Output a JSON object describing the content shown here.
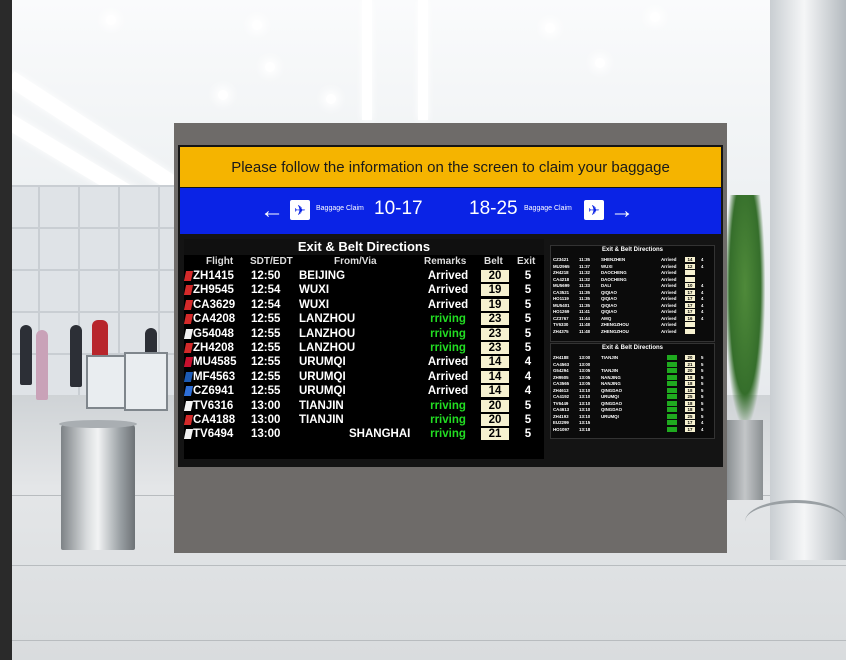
{
  "sign": {
    "banner": "Please follow the information on the screen to claim your baggage",
    "left_claim_label": "Baggage Claim",
    "left_claim_range": "10-17",
    "right_claim_range": "18-25",
    "right_claim_label": "Baggage Claim",
    "colors": {
      "yellow": "#f5b400",
      "blue": "#0a23e6",
      "arrived": "#ffffff",
      "arriving": "#22dd22"
    }
  },
  "main_board": {
    "title": "Exit & Belt Directions",
    "headers": {
      "flight": "Flight",
      "time": "SDT/EDT",
      "city": "From/Via",
      "remarks": "Remarks",
      "belt": "Belt",
      "exit": "Exit"
    },
    "rows": [
      {
        "flight": "ZH1415",
        "time": "12:50",
        "city": "BEIJING",
        "remarks": "Arrived",
        "belt": "20",
        "exit": "5",
        "status": "arrived",
        "logo": "#d42a2a"
      },
      {
        "flight": "ZH9545",
        "time": "12:54",
        "city": "WUXI",
        "remarks": "Arrived",
        "belt": "19",
        "exit": "5",
        "status": "arrived",
        "logo": "#d42a2a"
      },
      {
        "flight": "CA3629",
        "time": "12:54",
        "city": "WUXI",
        "remarks": "Arrived",
        "belt": "19",
        "exit": "5",
        "status": "arrived",
        "logo": "#d42a2a"
      },
      {
        "flight": "CA4208",
        "time": "12:55",
        "city": "LANZHOU",
        "remarks": "rriving",
        "belt": "23",
        "exit": "5",
        "status": "arriving",
        "logo": "#d42a2a"
      },
      {
        "flight": "G54048",
        "time": "12:55",
        "city": "LANZHOU",
        "remarks": "rriving",
        "belt": "23",
        "exit": "5",
        "status": "arriving",
        "logo": "#f2f2f2"
      },
      {
        "flight": "ZH4208",
        "time": "12:55",
        "city": "LANZHOU",
        "remarks": "rriving",
        "belt": "23",
        "exit": "5",
        "status": "arriving",
        "logo": "#d42a2a"
      },
      {
        "flight": "MU4585",
        "time": "12:55",
        "city": "URUMQI",
        "remarks": "Arrived",
        "belt": "14",
        "exit": "4",
        "status": "arrived",
        "logo": "#c8102e"
      },
      {
        "flight": "MF4563",
        "time": "12:55",
        "city": "URUMQI",
        "remarks": "Arrived",
        "belt": "14",
        "exit": "4",
        "status": "arrived",
        "logo": "#1c5bb5"
      },
      {
        "flight": "CZ6941",
        "time": "12:55",
        "city": "URUMQI",
        "remarks": "Arrived",
        "belt": "14",
        "exit": "4",
        "status": "arrived",
        "logo": "#2e6fd8"
      },
      {
        "flight": "TV6316",
        "time": "13:00",
        "city": "TIANJIN",
        "remarks": "rriving",
        "belt": "20",
        "exit": "5",
        "status": "arriving",
        "logo": "#f2f2f2"
      },
      {
        "flight": "CA4188",
        "time": "13:00",
        "city": "TIANJIN",
        "remarks": "rriving",
        "belt": "20",
        "exit": "5",
        "status": "arriving",
        "logo": "#d42a2a"
      },
      {
        "flight": "TV6494",
        "time": "13:00",
        "city": "SHANGHAI",
        "remarks": "rriving",
        "belt": "21",
        "exit": "5",
        "status": "arriving",
        "logo": "#f2f2f2"
      }
    ]
  },
  "mini_board_top": {
    "title": "Exit & Belt Directions",
    "rows": [
      {
        "flight": "CZ3421",
        "time": "11:35",
        "city": "SHENZHEN",
        "remarks": "Arrived",
        "belt": "14",
        "exit": "4"
      },
      {
        "flight": "MU2965",
        "time": "11:37",
        "city": "WUXI",
        "remarks": "Arrived",
        "belt": "12",
        "exit": "4"
      },
      {
        "flight": "ZH4218",
        "time": "11:32",
        "city": "DAOCHENG",
        "remarks": "Arrived",
        "belt": "",
        "exit": ""
      },
      {
        "flight": "CA4218",
        "time": "11:32",
        "city": "DAOCHENG",
        "remarks": "Arrived",
        "belt": "",
        "exit": ""
      },
      {
        "flight": "MU5699",
        "time": "11:33",
        "city": "DALI",
        "remarks": "Arrived",
        "belt": "10",
        "exit": "4"
      },
      {
        "flight": "CA3521",
        "time": "11:35",
        "city": "QIQIAO",
        "remarks": "Arrived",
        "belt": "17",
        "exit": "4"
      },
      {
        "flight": "HO1119",
        "time": "11:35",
        "city": "QIQIAO",
        "remarks": "Arrived",
        "belt": "17",
        "exit": "4"
      },
      {
        "flight": "MU5401",
        "time": "11:35",
        "city": "QIQIAO",
        "remarks": "Arrived",
        "belt": "17",
        "exit": "4"
      },
      {
        "flight": "HO1269",
        "time": "11:41",
        "city": "QIQIAO",
        "remarks": "Arrived",
        "belt": "17",
        "exit": "4"
      },
      {
        "flight": "CZ3767",
        "time": "11:44",
        "city": "AMQ",
        "remarks": "Arrived",
        "belt": "16",
        "exit": "4"
      },
      {
        "flight": "TV6330",
        "time": "11:48",
        "city": "ZHENGZHOU",
        "remarks": "Arrived",
        "belt": "",
        "exit": ""
      },
      {
        "flight": "ZH4375",
        "time": "11:48",
        "city": "ZHENGZHOU",
        "remarks": "Arrived",
        "belt": "",
        "exit": ""
      }
    ]
  },
  "mini_board_bottom": {
    "title": "Exit & Belt Directions",
    "rows": [
      {
        "flight": "ZH4188",
        "time": "13:00",
        "city": "TIANJIN",
        "belt": "20",
        "exit": "5"
      },
      {
        "flight": "CA4563",
        "time": "13:00",
        "city": "",
        "belt": "21",
        "exit": "5"
      },
      {
        "flight": "G54294",
        "time": "13:05",
        "city": "TIANJIN",
        "belt": "20",
        "exit": "5"
      },
      {
        "flight": "ZH9505",
        "time": "13:05",
        "city": "NANJING",
        "belt": "18",
        "exit": "5"
      },
      {
        "flight": "CA3565",
        "time": "13:05",
        "city": "NANJING",
        "belt": "18",
        "exit": "5"
      },
      {
        "flight": "ZH4613",
        "time": "13:10",
        "city": "QINGDAO",
        "belt": "18",
        "exit": "5"
      },
      {
        "flight": "CA4192",
        "time": "13:10",
        "city": "URUMQI",
        "belt": "25",
        "exit": "5"
      },
      {
        "flight": "TV6449",
        "time": "13:10",
        "city": "QINGDAO",
        "belt": "18",
        "exit": "5"
      },
      {
        "flight": "CA4613",
        "time": "13:10",
        "city": "QINGDAO",
        "belt": "18",
        "exit": "5"
      },
      {
        "flight": "ZH4193",
        "time": "13:10",
        "city": "URUMQI",
        "belt": "25",
        "exit": "5"
      },
      {
        "flight": "EU2299",
        "time": "13:15",
        "city": "",
        "belt": "17",
        "exit": "4"
      },
      {
        "flight": "HO1097",
        "time": "13:18",
        "city": "",
        "belt": "17",
        "exit": "4"
      }
    ]
  }
}
